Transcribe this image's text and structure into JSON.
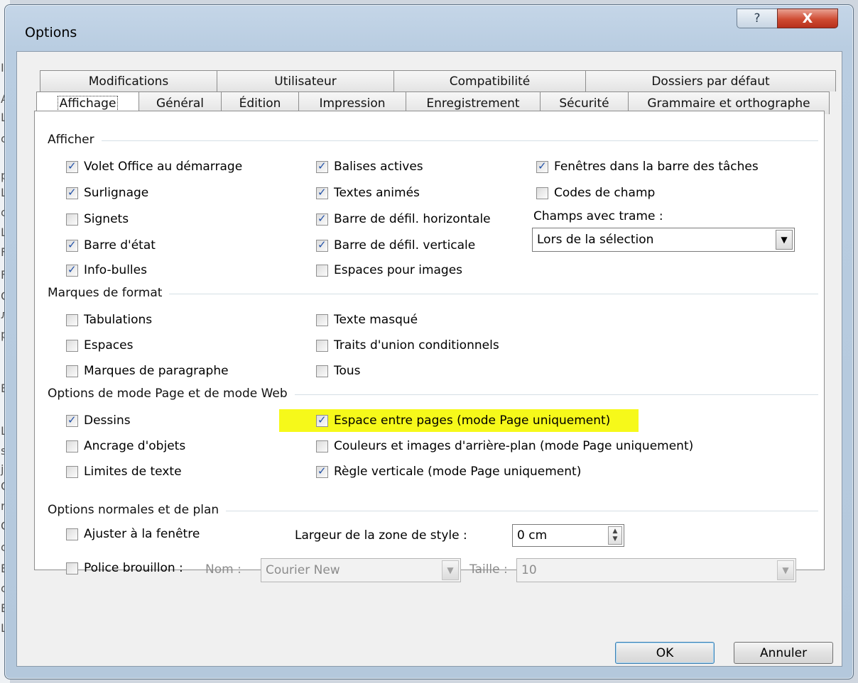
{
  "background_letters": [
    "I",
    "A",
    "L",
    "c",
    "p",
    "L",
    "c",
    "L",
    "F",
    "F",
    "C",
    "л",
    "p",
    "E",
    "L",
    "s",
    "j",
    "C",
    "r",
    "C",
    "c",
    "E",
    "c",
    "E",
    "L"
  ],
  "window": {
    "title": "Options",
    "help_label": "?",
    "close_label": "X"
  },
  "tabs": {
    "row_back": [
      "Modifications",
      "Utilisateur",
      "Compatibilité",
      "Dossiers par défaut"
    ],
    "row_front": [
      "Affichage",
      "Général",
      "Édition",
      "Impression",
      "Enregistrement",
      "Sécurité",
      "Grammaire et orthographe"
    ],
    "active": "Affichage"
  },
  "groups": {
    "afficher": "Afficher",
    "marques": "Marques de format",
    "page_web": "Options de mode Page et de mode Web",
    "normales": "Options normales et de plan"
  },
  "afficher": [
    {
      "label": "Volet Office au démarrage",
      "checked": true
    },
    {
      "label": "Surlignage",
      "checked": true
    },
    {
      "label": "Signets",
      "checked": false
    },
    {
      "label": "Barre d'état",
      "checked": true
    },
    {
      "label": "Info-bulles",
      "checked": true
    },
    {
      "label": "Balises actives",
      "checked": true
    },
    {
      "label": "Textes animés",
      "checked": true
    },
    {
      "label": "Barre de défil. horizontale",
      "checked": true
    },
    {
      "label": "Barre de défil. verticale",
      "checked": true
    },
    {
      "label": "Espaces pour images",
      "checked": false
    },
    {
      "label": "Fenêtres dans la barre des tâches",
      "checked": true
    },
    {
      "label": "Codes de champ",
      "checked": false
    }
  ],
  "champs": {
    "label": "Champs avec trame :",
    "value": "Lors de la sélection"
  },
  "marques": [
    {
      "label": "Tabulations",
      "checked": false
    },
    {
      "label": "Espaces",
      "checked": false
    },
    {
      "label": "Marques de paragraphe",
      "checked": false
    },
    {
      "label": "Texte masqué",
      "checked": false
    },
    {
      "label": "Traits d'union conditionnels",
      "checked": false
    },
    {
      "label": "Tous",
      "checked": false
    }
  ],
  "page_web": [
    {
      "label": "Dessins",
      "checked": true
    },
    {
      "label": "Ancrage d'objets",
      "checked": false
    },
    {
      "label": "Limites de texte",
      "checked": false
    },
    {
      "label": "Espace entre pages (mode Page uniquement)",
      "checked": true,
      "highlighted": true
    },
    {
      "label": "Couleurs et images d'arrière-plan (mode Page uniquement)",
      "checked": false
    },
    {
      "label": "Règle verticale (mode Page uniquement)",
      "checked": true
    }
  ],
  "normales": {
    "ajuster": {
      "label": "Ajuster à la fenêtre",
      "checked": false
    },
    "largeur_label": "Largeur de la zone de style :",
    "largeur_value": "0 cm",
    "police": {
      "label": "Police brouillon :",
      "checked": false
    },
    "nom_label": "Nom :",
    "nom_value": "Courier New",
    "taille_label": "Taille :",
    "taille_value": "10"
  },
  "buttons": {
    "ok": "OK",
    "cancel": "Annuler"
  },
  "colors": {
    "highlight": "#f6f91a",
    "check": "#2352a8",
    "close_button": "#cf4b32"
  }
}
